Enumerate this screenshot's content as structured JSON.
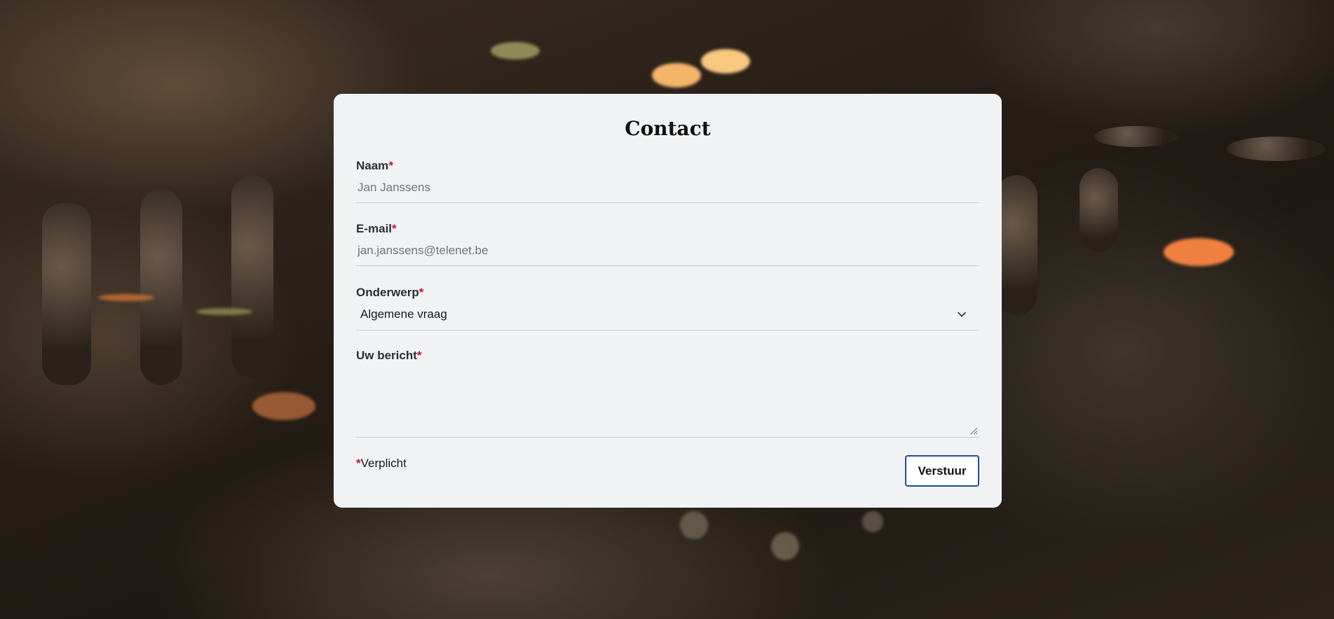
{
  "form": {
    "title": "Contact",
    "required_marker": "*",
    "fields": {
      "name": {
        "label": "Naam",
        "placeholder": "Jan Janssens"
      },
      "email": {
        "label": "E-mail",
        "placeholder": "jan.janssens@telenet.be"
      },
      "subject": {
        "label": "Onderwerp",
        "selected": "Algemene vraag",
        "icon": "chevron-down-icon"
      },
      "message": {
        "label": "Uw bericht",
        "value": ""
      }
    },
    "required_note": "Verplicht",
    "submit_label": "Verstuur"
  },
  "colors": {
    "card_background": "#f1f2f4",
    "required_red": "#c8102e",
    "button_border": "#1f4f8f"
  }
}
